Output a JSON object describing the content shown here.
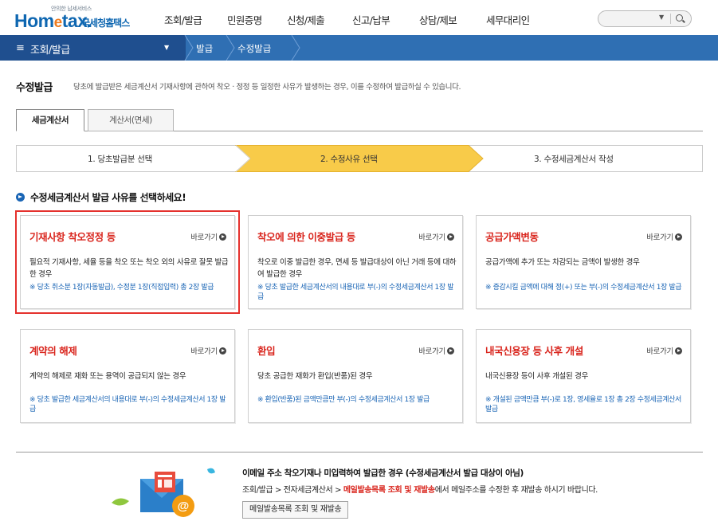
{
  "header": {
    "logo_tagline": "안의한 납세서비스",
    "logo_text": "Hometax.",
    "logo_sub": "국세청홈택스",
    "menu": [
      "조회/발급",
      "민원증명",
      "신청/제출",
      "신고/납부",
      "상담/제보",
      "세무대리인"
    ],
    "search_placeholder": ""
  },
  "lnb": {
    "title": "조회/발급",
    "crumbs": [
      "발급",
      "수정발급"
    ]
  },
  "page": {
    "title": "수정발급",
    "description": "당초에 발급받은 세금계산서 기재사항에 관하여 착오 · 정정 등 일정한 사유가 발생하는 경우, 이를 수정하여 발급하실 수 있습니다."
  },
  "tabs": [
    {
      "label": "세금계산서",
      "active": true
    },
    {
      "label": "계산서(면세)",
      "active": false
    }
  ],
  "steps": [
    {
      "label": "1. 당초발급분 선택",
      "current": false
    },
    {
      "label": "2. 수정사유 선택",
      "current": true
    },
    {
      "label": "3. 수정세금계산서 작성",
      "current": false
    }
  ],
  "section_heading": "수정세금계산서 발급 사유를 선택하세요!",
  "go_label": "바로가기",
  "cards": [
    {
      "title": "기재사항 착오정정 등",
      "desc": "필요적 기재사항, 세율 등을 착오 또는 착오 외의 사유로 잘못 발급한 경우",
      "note": "※ 당초 취소분 1장(자동발급), 수정분 1장(직접입력) 총 2장 발급",
      "highlighted": true
    },
    {
      "title": "착오에 의한 이중발급 등",
      "desc": "착오로 이중 발급한 경우, 면세 등 발급대상이 아닌 거래 등에 대하여 발급한 경우",
      "note": "※ 당초 발급한 세금계산서의 내용대로 부(-)의 수정세금계산서 1장 발급",
      "highlighted": false
    },
    {
      "title": "공급가액변동",
      "desc": "공급가액에 추가 또는 차감되는 금액이 발생한 경우",
      "note": "※ 증감시킬 금액에 대해 정(+) 또는 부(-)의 수정세금계산서 1장 발급",
      "highlighted": false
    },
    {
      "title": "계약의 해제",
      "desc": "계약의 해제로 재화 또는 용역이 공급되지 않는 경우",
      "note": "※ 당초 발급한 세금계산서의 내용대로 부(-)의 수정세금계산서 1장 발급",
      "highlighted": false
    },
    {
      "title": "환입",
      "desc": "당초 공급한 재화가 환입(반품)된 경우",
      "note": "※ 환입(반품)된 금액만큼만 부(-)의 수정세금계산서 1장 발급",
      "highlighted": false
    },
    {
      "title": "내국신용장 등 사후 개설",
      "desc": "내국신용장 등이 사후 개설된 경우",
      "note": "※ 개설된 금액만큼 부(-)로 1장, 영세율로 1장 총 2장 수정세금계산서 발급",
      "highlighted": false
    }
  ],
  "bottom": {
    "title": "이메일 주소 착오기재나 미입력하여 발급한 경우 (수정세금계산서 발급 대상이 아님)",
    "desc_prefix": "조회/발급 > 전자세금계산서 > ",
    "desc_link": "메일발송목록 조회 및 재발송",
    "desc_suffix": "에서 메일주소를 수정한 후 재발송 하시기 바랍니다.",
    "button": "메일발송목록 조회 및 재발송"
  },
  "colors": {
    "brand_blue": "#0f67b1",
    "lnb_blue": "#2f6fb3",
    "step_current": "#f8cb49",
    "card_title_red": "#d9251d",
    "highlight_red": "#e5312d",
    "note_blue": "#1a65b5"
  }
}
